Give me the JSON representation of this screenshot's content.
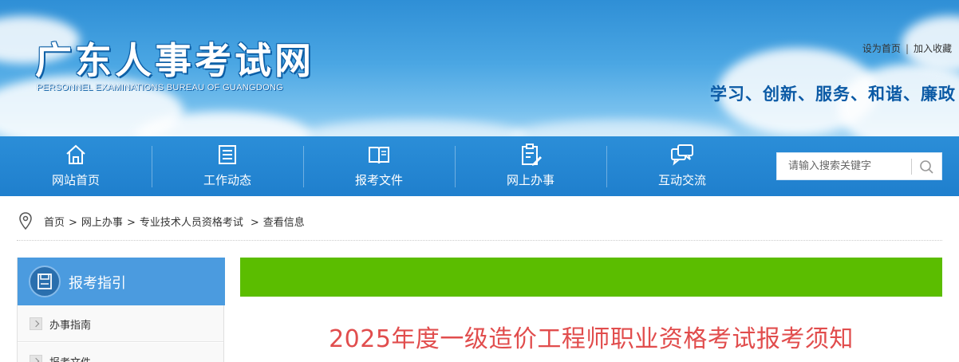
{
  "header": {
    "logo_cn": "广东人事考试网",
    "logo_en": "PERSONNEL EXAMINATIONS BUREAU OF GUANGDONG",
    "links": [
      {
        "label": "设为首页"
      },
      {
        "label": "加入收藏"
      }
    ],
    "link_separator": "|",
    "slogan": "学习、创新、服务、和谐、廉政"
  },
  "nav": {
    "items": [
      {
        "label": "网站首页",
        "icon": "home-icon"
      },
      {
        "label": "工作动态",
        "icon": "news-list-icon"
      },
      {
        "label": "报考文件",
        "icon": "book-icon"
      },
      {
        "label": "网上办事",
        "icon": "clipboard-edit-icon"
      },
      {
        "label": "互动交流",
        "icon": "chat-bubbles-icon"
      }
    ],
    "search": {
      "placeholder": "请输入搜索关键字",
      "icon": "search-icon"
    }
  },
  "breadcrumb": {
    "icon": "location-pin-icon",
    "items": [
      "首页",
      "网上办事",
      "专业技术人员资格考试",
      "查看信息"
    ],
    "separator": ">"
  },
  "sidebar": {
    "title": "报考指引",
    "items": [
      {
        "label": "办事指南"
      },
      {
        "label": "报考文件"
      }
    ]
  },
  "main": {
    "bar_color": "#5bbd00",
    "title": "2025年度一级造价工程师职业资格考试报考须知"
  },
  "colors": {
    "nav_blue": "#1f7fcd",
    "sidebar_blue": "#4b9bdf",
    "title_red": "#e14d4d",
    "slogan_blue": "#0b5aa5"
  }
}
